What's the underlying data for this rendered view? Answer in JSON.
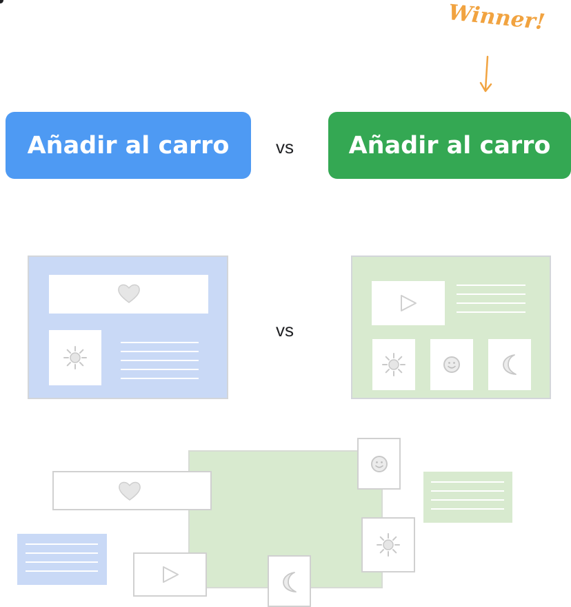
{
  "top": {
    "button_left": {
      "label": "Añadir al carro",
      "color": "#4e9af3"
    },
    "vs_label": "vs",
    "button_right": {
      "label": "Añadir al carro",
      "color": "#34a853"
    },
    "winner_note": "Winner!",
    "winner_color": "#f1a340"
  },
  "middle": {
    "vs_label": "vs",
    "left_layout_color": "#c9d9f6",
    "right_layout_color": "#d8eacf"
  },
  "icons": [
    "heart-icon",
    "sun-icon",
    "play-icon",
    "smiley-icon",
    "moon-icon"
  ]
}
